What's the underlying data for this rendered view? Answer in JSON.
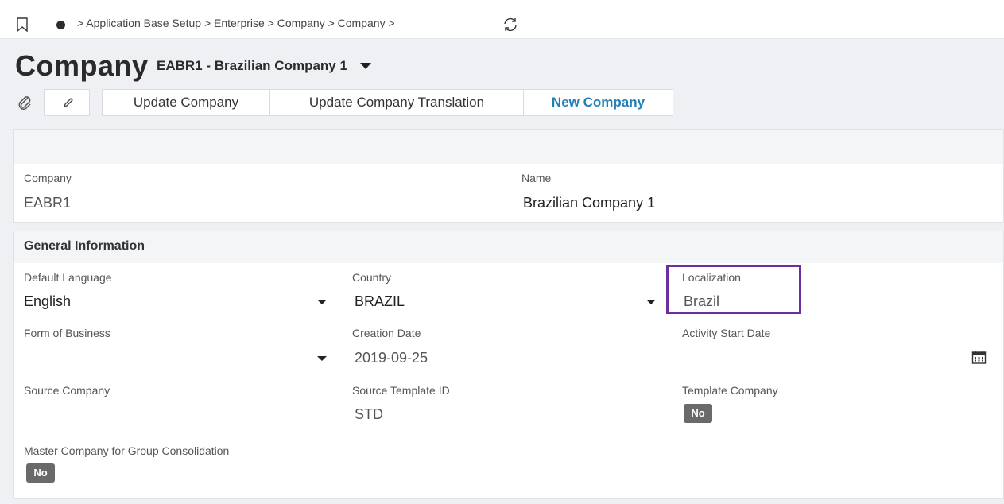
{
  "topbar": {
    "bookmark_icon": "bookmark-icon",
    "breadcrumb": "> Application Base Setup > Enterprise > Company > Company >",
    "refresh_icon": "refresh-icon"
  },
  "header": {
    "title": "Company",
    "subtitle": "EABR1 - Brazilian Company 1"
  },
  "toolbar": {
    "attach_icon": "paperclip-icon",
    "edit_icon": "pencil-icon",
    "commands": [
      {
        "label": "Update Company"
      },
      {
        "label": "Update Company Translation"
      },
      {
        "label": "New Company"
      }
    ]
  },
  "record": {
    "company_label": "Company",
    "company_value": "EABR1",
    "name_label": "Name",
    "name_value": "Brazilian Company 1"
  },
  "general": {
    "title": "General Information",
    "default_language_label": "Default Language",
    "default_language_value": "English",
    "country_label": "Country",
    "country_value": "BRAZIL",
    "localization_label": "Localization",
    "localization_value": "Brazil",
    "form_of_business_label": "Form of Business",
    "form_of_business_value": "",
    "creation_date_label": "Creation Date",
    "creation_date_value": "2019-09-25",
    "activity_start_date_label": "Activity Start Date",
    "activity_start_date_value": "",
    "source_company_label": "Source Company",
    "source_company_value": "",
    "source_template_id_label": "Source Template ID",
    "source_template_id_value": "STD",
    "template_company_label": "Template Company",
    "template_company_value": "No",
    "master_company_label": "Master Company for Group Consolidation",
    "master_company_value": "No"
  },
  "colors": {
    "accent": "#1f7fb6",
    "highlight": "#6b2fa0",
    "badge": "#6a6a6a"
  }
}
